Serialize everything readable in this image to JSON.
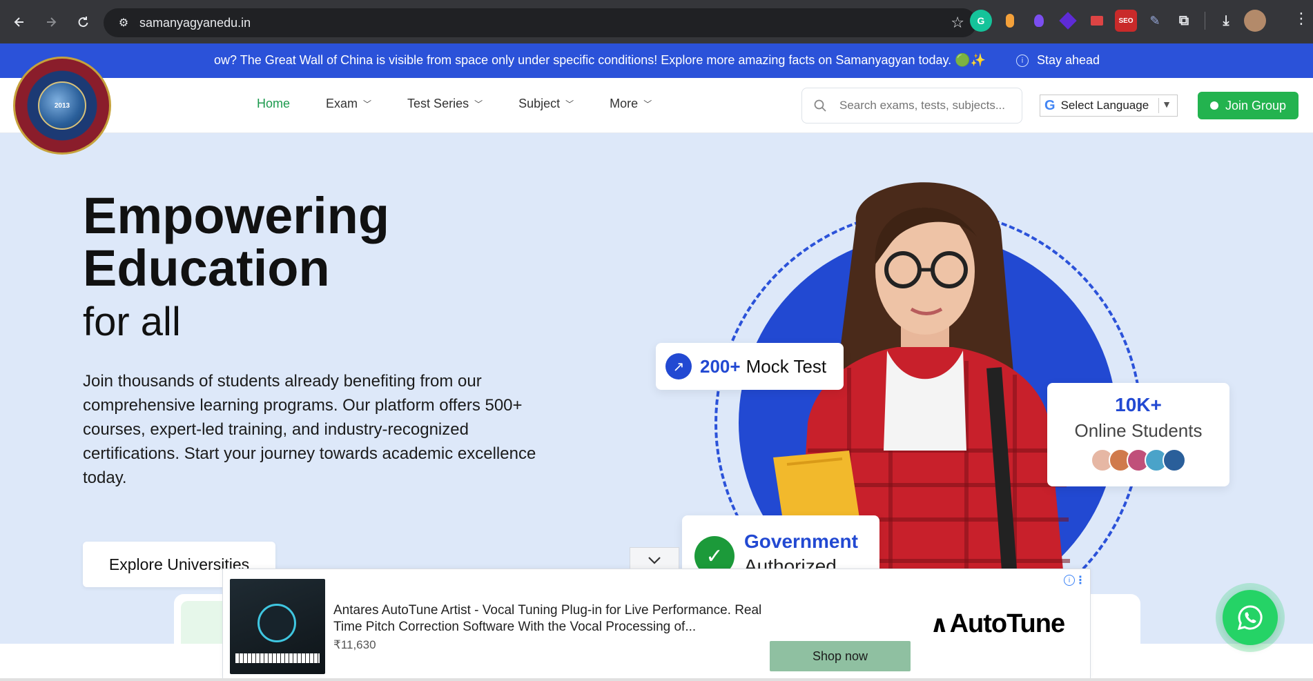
{
  "browser": {
    "url": "samanyagyanedu.in",
    "back_icon": "arrow-left-icon",
    "forward_icon": "arrow-right-icon",
    "reload_icon": "reload-icon",
    "bookmark_icon": "star-icon"
  },
  "marquee": {
    "text": "ow? The Great Wall of China is visible from space only under specific conditions! Explore more amazing facts on Samanyagyan today. 🟢✨",
    "next_text": "Stay ahead"
  },
  "header": {
    "logo_year": "2013",
    "nav": [
      {
        "label": "Home",
        "active": true
      },
      {
        "label": "Exam",
        "dropdown": true
      },
      {
        "label": "Test Series",
        "dropdown": true
      },
      {
        "label": "Subject",
        "dropdown": true
      },
      {
        "label": "More",
        "dropdown": true
      }
    ],
    "search_placeholder": "Search exams, tests, subjects...",
    "language_label": "Select Language",
    "join_label": "Join Group"
  },
  "hero": {
    "title_line1": "Empowering",
    "title_line2": "Education",
    "subtitle": "for all",
    "description": "Join thousands of students already benefiting from our comprehensive learning programs. Our platform offers 500+ courses, expert-led training, and industry-recognized certifications. Start your journey towards academic excellence today.",
    "cta": "Explore Universities",
    "mock_card": {
      "number": "200+",
      "label": "Mock Test"
    },
    "students_card": {
      "number": "10K+",
      "label": "Online Students"
    },
    "gov_card": {
      "line1": "Government",
      "line2": "Authorized"
    }
  },
  "ad": {
    "title": "Antares AutoTune Artist - Vocal Tuning Plug-in for Live Performance. Real Time Pitch Correction Software With the Vocal Processing of...",
    "price": "₹11,630",
    "cta": "Shop now",
    "brand": "AutoTune"
  },
  "colors": {
    "primary_blue": "#2249d2",
    "marquee_blue": "#2b52d9",
    "green": "#23b34f",
    "hero_bg": "#dde8f9"
  }
}
